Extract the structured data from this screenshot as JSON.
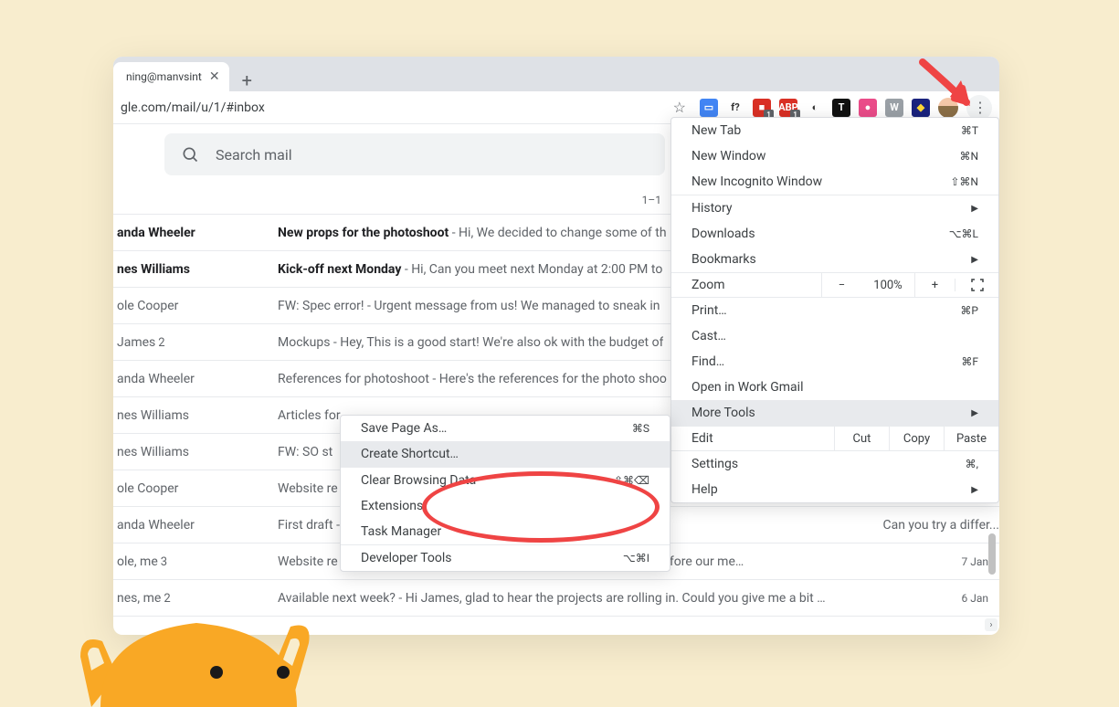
{
  "tab": {
    "title": "ning@manvsint",
    "close": "✕"
  },
  "url": "gle.com/mail/u/1/#inbox",
  "search": {
    "placeholder": "Search mail"
  },
  "count": "1–1",
  "extensions": [
    {
      "bg": "#4285f4",
      "txt": "▭"
    },
    {
      "bg": "#fff",
      "txt": "f?",
      "fg": "#333"
    },
    {
      "bg": "#d93025",
      "txt": "■",
      "badged": true
    },
    {
      "bg": "#d93025",
      "txt": "ABP",
      "badged": true
    },
    {
      "bg": "#fff",
      "txt": "◐",
      "fg": "#333"
    },
    {
      "bg": "#111",
      "txt": "T",
      "fg": "#fff"
    },
    {
      "bg": "#ea4c89",
      "txt": "●"
    },
    {
      "bg": "#9aa0a6",
      "txt": "W"
    },
    {
      "bg": "#1a237e",
      "txt": "◆",
      "fg": "#fdd835"
    }
  ],
  "emails": [
    {
      "sender": "anda Wheeler",
      "unread": true,
      "subj": "New props for the photoshoot",
      "preview": " - Hi, We decided to change some of th"
    },
    {
      "sender": "nes Williams",
      "unread": true,
      "subj": "Kick-off next Monday",
      "preview": " - Hi, Can you meet next Monday at 2:00 PM to"
    },
    {
      "sender": "ole Cooper",
      "unread": false,
      "subj": "FW: Spec error!",
      "preview": " - Urgent message from us! We managed to sneak in"
    },
    {
      "sender": "James",
      "count": "2",
      "unread": false,
      "subj": "Mockups",
      "preview": " - Hey, This is a good start! We're also ok with the budget of"
    },
    {
      "sender": "anda Wheeler",
      "unread": false,
      "subj": "References for photoshoot",
      "preview": " - Here's the references for the photo shoo"
    },
    {
      "sender": "nes Williams",
      "unread": false,
      "subj": "Articles for",
      "preview": ""
    },
    {
      "sender": "nes Williams",
      "unread": false,
      "subj": "FW: S",
      "preview": "O st"
    },
    {
      "sender": "ole Cooper",
      "unread": false,
      "subj": "Website re",
      "preview": ""
    },
    {
      "sender": "anda Wheeler",
      "unread": false,
      "subj": "First draft -",
      "preview": "",
      "extra": "Can you try a differ..."
    },
    {
      "sender": "ole, me",
      "count": "3",
      "unread": false,
      "subj": "Website re",
      "preview": "",
      "extra": "kground info before our me…",
      "date": "7 Jan"
    },
    {
      "sender": "nes, me",
      "count": "2",
      "unread": false,
      "subj": "Available next week?",
      "preview": " - Hi James, glad to hear the projects are rolling in. Could you give me a bit …",
      "date": "6 Jan"
    }
  ],
  "menu": {
    "newTab": "New Tab",
    "newTabKey": "⌘T",
    "newWindow": "New Window",
    "newWindowKey": "⌘N",
    "incognito": "New Incognito Window",
    "incognitoKey": "⇧⌘N",
    "history": "History",
    "downloads": "Downloads",
    "downloadsKey": "⌥⌘L",
    "bookmarks": "Bookmarks",
    "zoom": "Zoom",
    "zoomVal": "100%",
    "minus": "−",
    "plus": "+",
    "print": "Print…",
    "printKey": "⌘P",
    "cast": "Cast…",
    "find": "Find…",
    "findKey": "⌘F",
    "openWork": "Open in Work Gmail",
    "moreTools": "More Tools",
    "edit": "Edit",
    "cut": "Cut",
    "copy": "Copy",
    "paste": "Paste",
    "settings": "Settings",
    "settingsKey": "⌘,",
    "help": "Help"
  },
  "submenu": {
    "savePage": "Save Page As…",
    "savePageKey": "⌘S",
    "createShortcut": "Create Shortcut…",
    "clearData": "Clear Browsing Data",
    "clearDataKey": "⇧⌘⌫",
    "extensions": "Extensions",
    "taskManager": "Task Manager",
    "devTools": "Developer Tools",
    "devToolsKey": "⌥⌘I"
  }
}
